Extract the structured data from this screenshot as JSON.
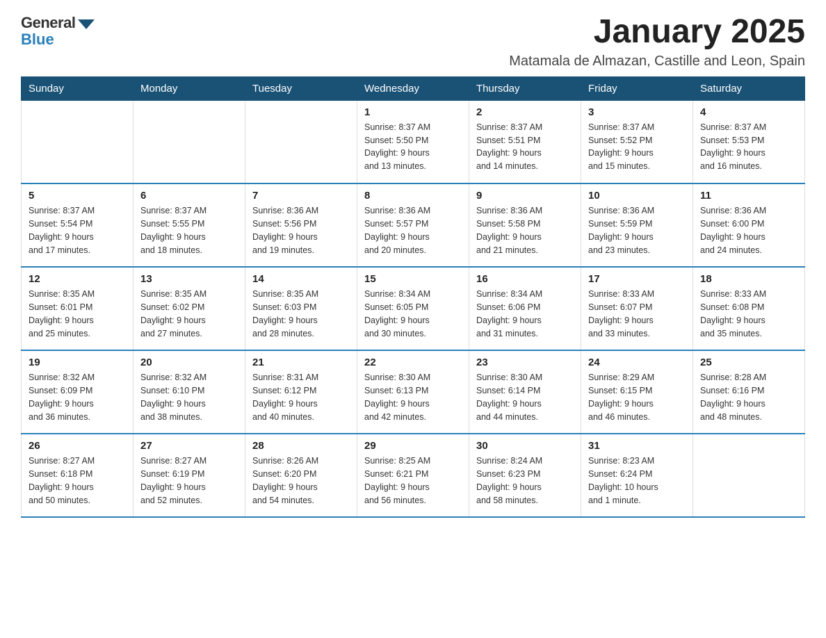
{
  "logo": {
    "general": "General",
    "blue": "Blue"
  },
  "header": {
    "title": "January 2025",
    "subtitle": "Matamala de Almazan, Castille and Leon, Spain"
  },
  "weekdays": [
    "Sunday",
    "Monday",
    "Tuesday",
    "Wednesday",
    "Thursday",
    "Friday",
    "Saturday"
  ],
  "weeks": [
    [
      {
        "day": "",
        "info": ""
      },
      {
        "day": "",
        "info": ""
      },
      {
        "day": "",
        "info": ""
      },
      {
        "day": "1",
        "info": "Sunrise: 8:37 AM\nSunset: 5:50 PM\nDaylight: 9 hours\nand 13 minutes."
      },
      {
        "day": "2",
        "info": "Sunrise: 8:37 AM\nSunset: 5:51 PM\nDaylight: 9 hours\nand 14 minutes."
      },
      {
        "day": "3",
        "info": "Sunrise: 8:37 AM\nSunset: 5:52 PM\nDaylight: 9 hours\nand 15 minutes."
      },
      {
        "day": "4",
        "info": "Sunrise: 8:37 AM\nSunset: 5:53 PM\nDaylight: 9 hours\nand 16 minutes."
      }
    ],
    [
      {
        "day": "5",
        "info": "Sunrise: 8:37 AM\nSunset: 5:54 PM\nDaylight: 9 hours\nand 17 minutes."
      },
      {
        "day": "6",
        "info": "Sunrise: 8:37 AM\nSunset: 5:55 PM\nDaylight: 9 hours\nand 18 minutes."
      },
      {
        "day": "7",
        "info": "Sunrise: 8:36 AM\nSunset: 5:56 PM\nDaylight: 9 hours\nand 19 minutes."
      },
      {
        "day": "8",
        "info": "Sunrise: 8:36 AM\nSunset: 5:57 PM\nDaylight: 9 hours\nand 20 minutes."
      },
      {
        "day": "9",
        "info": "Sunrise: 8:36 AM\nSunset: 5:58 PM\nDaylight: 9 hours\nand 21 minutes."
      },
      {
        "day": "10",
        "info": "Sunrise: 8:36 AM\nSunset: 5:59 PM\nDaylight: 9 hours\nand 23 minutes."
      },
      {
        "day": "11",
        "info": "Sunrise: 8:36 AM\nSunset: 6:00 PM\nDaylight: 9 hours\nand 24 minutes."
      }
    ],
    [
      {
        "day": "12",
        "info": "Sunrise: 8:35 AM\nSunset: 6:01 PM\nDaylight: 9 hours\nand 25 minutes."
      },
      {
        "day": "13",
        "info": "Sunrise: 8:35 AM\nSunset: 6:02 PM\nDaylight: 9 hours\nand 27 minutes."
      },
      {
        "day": "14",
        "info": "Sunrise: 8:35 AM\nSunset: 6:03 PM\nDaylight: 9 hours\nand 28 minutes."
      },
      {
        "day": "15",
        "info": "Sunrise: 8:34 AM\nSunset: 6:05 PM\nDaylight: 9 hours\nand 30 minutes."
      },
      {
        "day": "16",
        "info": "Sunrise: 8:34 AM\nSunset: 6:06 PM\nDaylight: 9 hours\nand 31 minutes."
      },
      {
        "day": "17",
        "info": "Sunrise: 8:33 AM\nSunset: 6:07 PM\nDaylight: 9 hours\nand 33 minutes."
      },
      {
        "day": "18",
        "info": "Sunrise: 8:33 AM\nSunset: 6:08 PM\nDaylight: 9 hours\nand 35 minutes."
      }
    ],
    [
      {
        "day": "19",
        "info": "Sunrise: 8:32 AM\nSunset: 6:09 PM\nDaylight: 9 hours\nand 36 minutes."
      },
      {
        "day": "20",
        "info": "Sunrise: 8:32 AM\nSunset: 6:10 PM\nDaylight: 9 hours\nand 38 minutes."
      },
      {
        "day": "21",
        "info": "Sunrise: 8:31 AM\nSunset: 6:12 PM\nDaylight: 9 hours\nand 40 minutes."
      },
      {
        "day": "22",
        "info": "Sunrise: 8:30 AM\nSunset: 6:13 PM\nDaylight: 9 hours\nand 42 minutes."
      },
      {
        "day": "23",
        "info": "Sunrise: 8:30 AM\nSunset: 6:14 PM\nDaylight: 9 hours\nand 44 minutes."
      },
      {
        "day": "24",
        "info": "Sunrise: 8:29 AM\nSunset: 6:15 PM\nDaylight: 9 hours\nand 46 minutes."
      },
      {
        "day": "25",
        "info": "Sunrise: 8:28 AM\nSunset: 6:16 PM\nDaylight: 9 hours\nand 48 minutes."
      }
    ],
    [
      {
        "day": "26",
        "info": "Sunrise: 8:27 AM\nSunset: 6:18 PM\nDaylight: 9 hours\nand 50 minutes."
      },
      {
        "day": "27",
        "info": "Sunrise: 8:27 AM\nSunset: 6:19 PM\nDaylight: 9 hours\nand 52 minutes."
      },
      {
        "day": "28",
        "info": "Sunrise: 8:26 AM\nSunset: 6:20 PM\nDaylight: 9 hours\nand 54 minutes."
      },
      {
        "day": "29",
        "info": "Sunrise: 8:25 AM\nSunset: 6:21 PM\nDaylight: 9 hours\nand 56 minutes."
      },
      {
        "day": "30",
        "info": "Sunrise: 8:24 AM\nSunset: 6:23 PM\nDaylight: 9 hours\nand 58 minutes."
      },
      {
        "day": "31",
        "info": "Sunrise: 8:23 AM\nSunset: 6:24 PM\nDaylight: 10 hours\nand 1 minute."
      },
      {
        "day": "",
        "info": ""
      }
    ]
  ]
}
